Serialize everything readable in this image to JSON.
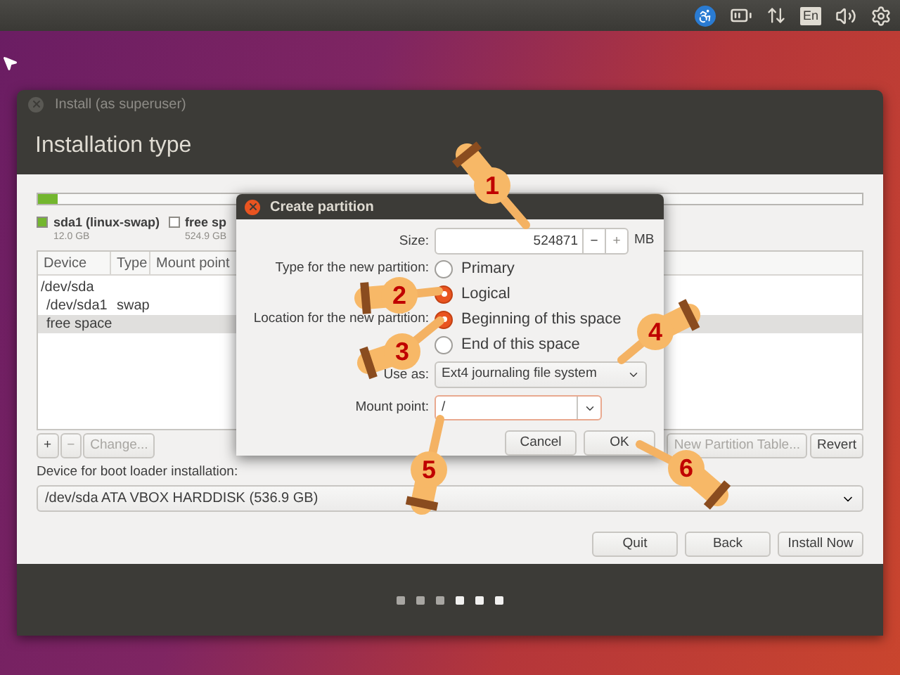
{
  "top_bar": {
    "keyboard_layout": "En"
  },
  "window": {
    "title": "Install (as superuser)",
    "heading": "Installation type"
  },
  "usage_bar": {
    "level": 0.024
  },
  "legend": [
    {
      "name": "sda1 (linux-swap)",
      "size": "12.0 GB",
      "color": "#73b62e"
    },
    {
      "name": "free sp",
      "size": "524.9 GB",
      "color": "#ffffff"
    }
  ],
  "table": {
    "columns": [
      "Device",
      "Type",
      "Mount point"
    ],
    "rows": [
      {
        "device": "/dev/sda",
        "selected": false,
        "children": [
          {
            "device": "/dev/sda1",
            "type": "swap",
            "selected": false
          },
          {
            "device": "free space",
            "selected": true
          }
        ]
      }
    ]
  },
  "table_buttons": [
    {
      "label": "+",
      "disabled": false
    },
    {
      "label": "−",
      "disabled": true
    },
    {
      "label": "Change...",
      "disabled": true
    }
  ],
  "table_buttons_right": [
    {
      "label": "New Partition Table...",
      "disabled": true
    },
    {
      "label": "Revert",
      "disabled": false
    }
  ],
  "boot_loader": {
    "label": "Device for boot loader installation:",
    "value": "/dev/sda ATA VBOX HARDDISK (536.9 GB)"
  },
  "buttons": [
    "Quit",
    "Back",
    "Install Now"
  ],
  "progress_dots": [
    {
      "lit": false
    },
    {
      "lit": false
    },
    {
      "lit": false
    },
    {
      "lit": true
    },
    {
      "lit": true
    },
    {
      "lit": true
    }
  ],
  "dialog": {
    "title": "Create partition",
    "size": {
      "label": "Size:",
      "value": "524871",
      "minus": "−",
      "plus": "+",
      "unit": "MB"
    },
    "type": {
      "label": "Type for the new partition:",
      "options": [
        {
          "label": "Primary",
          "selected": false
        },
        {
          "label": "Logical",
          "selected": true
        }
      ]
    },
    "location": {
      "label": "Location for the new partition:",
      "options": [
        {
          "label": "Beginning of this space",
          "selected": true
        },
        {
          "label": "End of this space",
          "selected": false
        }
      ]
    },
    "use_as": {
      "label": "Use as:",
      "value": "Ext4 journaling file system"
    },
    "mount_point": {
      "label": "Mount point:",
      "value": "/"
    },
    "buttons": [
      "Cancel",
      "OK"
    ]
  },
  "callouts": [
    {
      "number": "1"
    },
    {
      "number": "2"
    },
    {
      "number": "3"
    },
    {
      "number": "4"
    },
    {
      "number": "5"
    },
    {
      "number": "6"
    }
  ]
}
